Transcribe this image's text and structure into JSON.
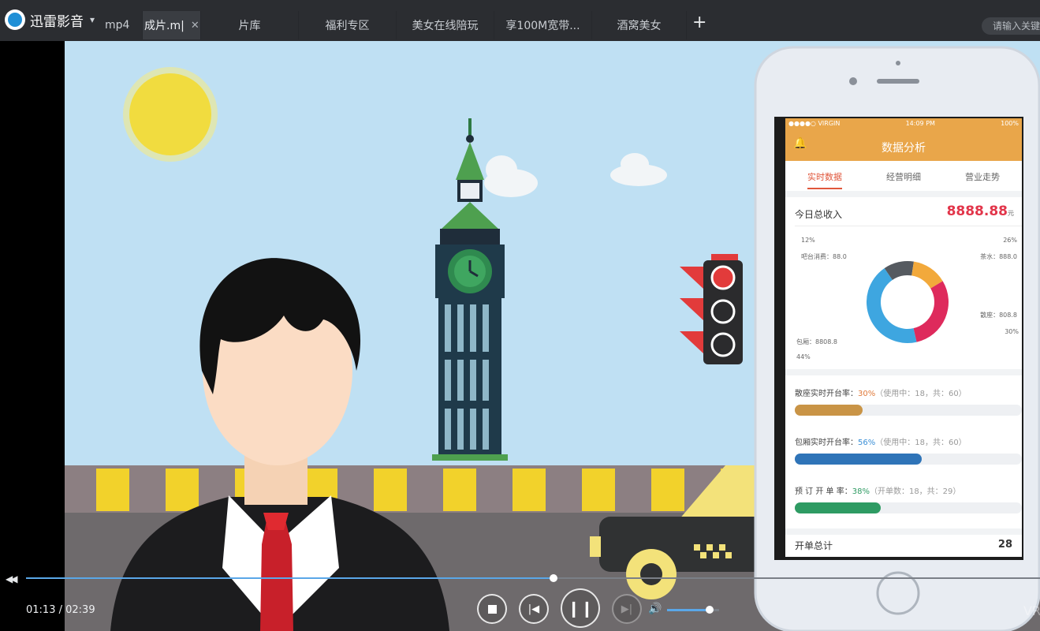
{
  "app": {
    "name": "迅雷影音"
  },
  "tabs": [
    {
      "label": "mp4",
      "active": false
    },
    {
      "label": "成片.m|",
      "active": true
    },
    {
      "label": "片库",
      "active": false
    },
    {
      "label": "福利专区",
      "active": false
    },
    {
      "label": "美女在线陪玩",
      "active": false
    },
    {
      "label": "享100M宽带...",
      "active": false
    },
    {
      "label": "酒窝美女",
      "active": false
    }
  ],
  "search": {
    "placeholder": "请输入关键"
  },
  "phone": {
    "status": {
      "carrier": "●●●●○ VIRGIN",
      "time": "14:09 PM",
      "battery": "100%"
    },
    "title": "数据分析",
    "tabs": [
      "实时数据",
      "经营明细",
      "营业走势"
    ],
    "income": {
      "label": "今日总收入",
      "value": "8888.88",
      "unit": "元"
    },
    "donut": [
      {
        "label": "吧台消费：88.0",
        "pct": "12%",
        "value": 12,
        "color": "#555a60"
      },
      {
        "label": "茶水：888.0",
        "pct": "26%",
        "value": 14,
        "color": "#f2a93b"
      },
      {
        "label": "散座：808.8",
        "pct": "30%",
        "value": 30,
        "color": "#de2a5c"
      },
      {
        "label": "包厢：8808.8",
        "pct": "44%",
        "value": 44,
        "color": "#3ea6e0"
      }
    ],
    "rates": [
      {
        "name": "散座实时开台率：",
        "pct_text": "30%",
        "detail": "（使用中：18，共：60）",
        "value": 0.3,
        "color": "#c99446",
        "pct_color": "#e07a3a"
      },
      {
        "name": "包厢实时开台率：",
        "pct_text": "56%",
        "detail": "（使用中：18，共：60）",
        "value": 0.56,
        "color": "#2f74b8",
        "pct_color": "#3b8fd6"
      },
      {
        "name": "预 订 开 单 率：",
        "pct_text": "38%",
        "detail": "（开单数：18，共：29）",
        "value": 0.38,
        "color": "#2e9b63",
        "pct_color": "#2e9b63"
      }
    ],
    "total": {
      "label": "开单总计",
      "value": "28"
    }
  },
  "player": {
    "current_time": "01:13",
    "total_time": "02:39",
    "progress": 0.52,
    "volume": 0.82,
    "corner_text": "VR"
  },
  "colors": {
    "sky": "#bfe0f3",
    "phone_header": "#e9a64a",
    "accent_red": "#e23b3b"
  }
}
